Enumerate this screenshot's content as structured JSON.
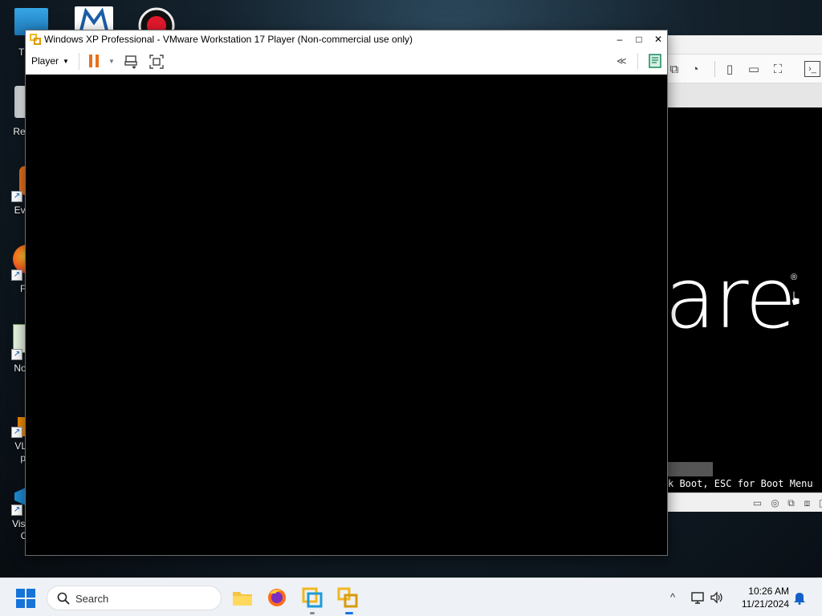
{
  "desktop": {
    "icons": [
      {
        "label": "Th"
      },
      {
        "label": "Recy"
      },
      {
        "label": "Ever"
      },
      {
        "label": "Fi"
      },
      {
        "label": "Note"
      },
      {
        "label": "VLC",
        "label2": "pl"
      },
      {
        "label": "Visua",
        "label2": "C"
      }
    ],
    "top_icons": [
      "app-icon",
      "malwarebytes-icon",
      "recorder-icon"
    ]
  },
  "background_window": {
    "brand_partial": "are",
    "reg_mark": "®",
    "bios_text": "k Boot, ESC for Boot Menu"
  },
  "vm_window": {
    "title": "Windows XP Professional - VMware Workstation 17 Player (Non-commercial use only)",
    "player_menu": "Player",
    "minimize_glyph": "–",
    "maximize_glyph": "□",
    "close_glyph": "✕",
    "collapse_glyph": "≪",
    "caret_glyph": "▼"
  },
  "taskbar": {
    "search_label": "Search",
    "tray_chevron": "^",
    "clock_time": "10:26 AM",
    "clock_date": "11/21/2024",
    "apps": [
      "file-explorer-icon",
      "firefox-icon",
      "vmware-workstation-icon",
      "vmware-player-icon"
    ]
  },
  "colors": {
    "pause_orange": "#e8701a",
    "start_blue": "#1673d8",
    "vm_yellow": "#f0b71f"
  }
}
